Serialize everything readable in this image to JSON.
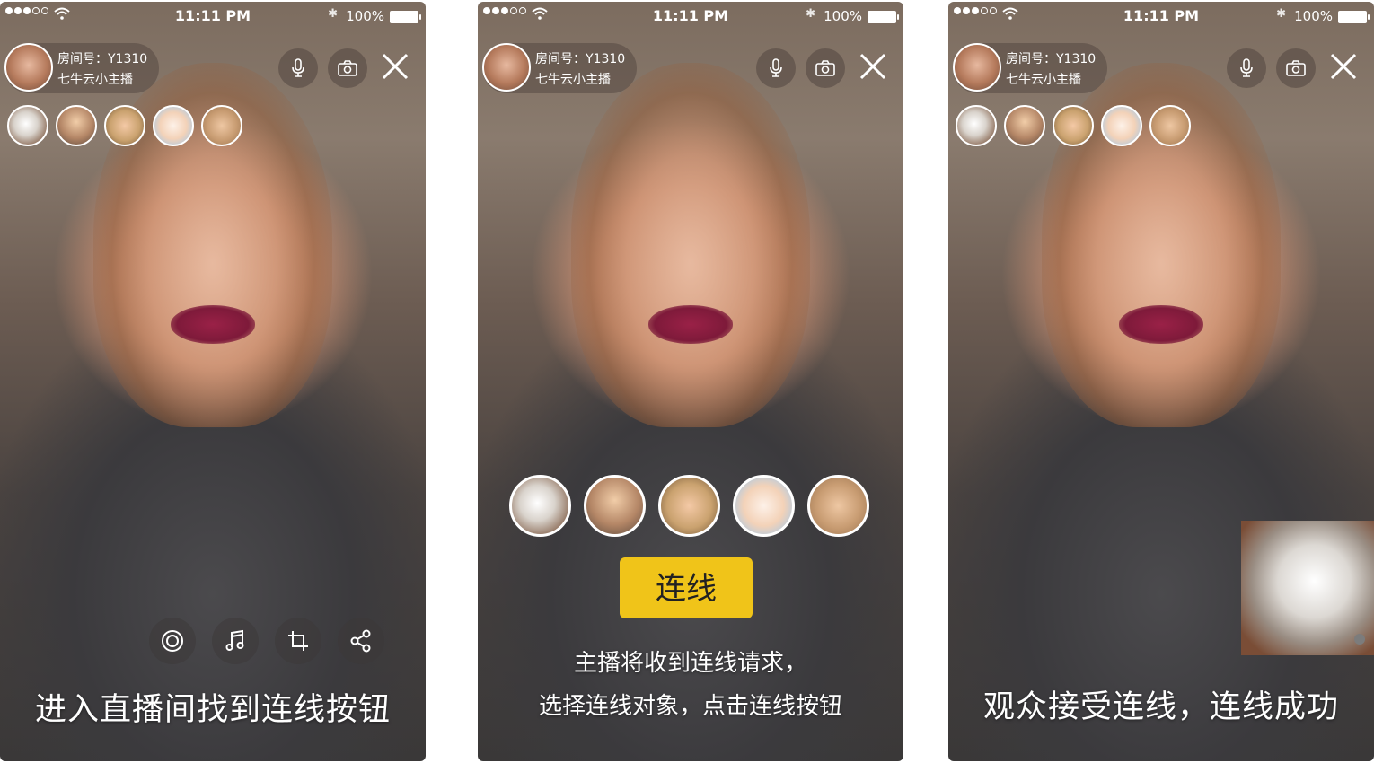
{
  "status": {
    "time": "11:11 PM",
    "battery": "100%"
  },
  "host": {
    "room": "房间号：Y1310",
    "name": "七牛云小主播"
  },
  "screen1": {
    "caption": "进入直播间找到连线按钮"
  },
  "screen2": {
    "button": "连线",
    "caption_line1": "主播将收到连线请求，",
    "caption_line2": "选择连线对象，点击连线按钮"
  },
  "screen3": {
    "caption": "观众接受连线，连线成功"
  },
  "icons": [
    "mic-icon",
    "camera-icon",
    "close-icon",
    "beauty-icon",
    "music-icon",
    "crop-icon",
    "share-icon",
    "wifi-icon",
    "bluetooth-icon",
    "battery-icon"
  ],
  "colors": {
    "accent_yellow": "#f0c419"
  }
}
